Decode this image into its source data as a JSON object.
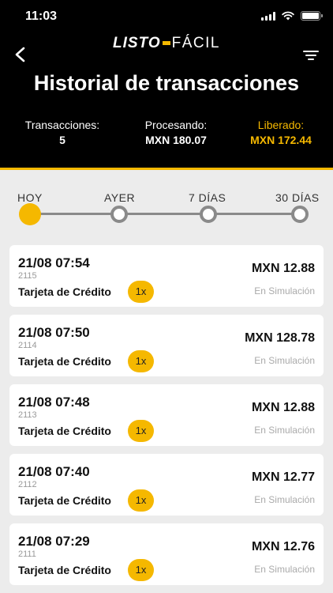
{
  "status_bar": {
    "time": "11:03"
  },
  "logo": {
    "part1": "LISTO",
    "part2": "FÁCIL"
  },
  "header": {
    "title": "Historial de transacciones"
  },
  "summary": {
    "transactions": {
      "label": "Transacciones:",
      "value": "5"
    },
    "processing": {
      "label": "Procesando:",
      "value": "MXN 180.07"
    },
    "released": {
      "label": "Liberado:",
      "value": "MXN 172.44"
    }
  },
  "timeline": {
    "options": [
      "HOY",
      "AYER",
      "7 DÍAS",
      "30 DÍAS"
    ],
    "selected": "HOY"
  },
  "transactions": [
    {
      "date": "21/08 07:54",
      "id": "2115",
      "method": "Tarjeta de Crédito",
      "installments": "1x",
      "amount": "MXN 12.88",
      "status": "En Simulación"
    },
    {
      "date": "21/08 07:50",
      "id": "2114",
      "method": "Tarjeta de Crédito",
      "installments": "1x",
      "amount": "MXN 128.78",
      "status": "En Simulación"
    },
    {
      "date": "21/08 07:48",
      "id": "2113",
      "method": "Tarjeta de Crédito",
      "installments": "1x",
      "amount": "MXN 12.88",
      "status": "En Simulación"
    },
    {
      "date": "21/08 07:40",
      "id": "2112",
      "method": "Tarjeta de Crédito",
      "installments": "1x",
      "amount": "MXN 12.77",
      "status": "En Simulación"
    },
    {
      "date": "21/08 07:29",
      "id": "2111",
      "method": "Tarjeta de Crédito",
      "installments": "1x",
      "amount": "MXN 12.76",
      "status": "En Simulación"
    }
  ],
  "colors": {
    "accent": "#f5b800",
    "header_bg": "#000000",
    "page_bg": "#ececec"
  },
  "icons": {
    "back": "chevron-left-icon",
    "filter": "filter-icon",
    "wifi": "wifi-icon",
    "battery": "battery-icon",
    "signal": "signal-icon"
  }
}
